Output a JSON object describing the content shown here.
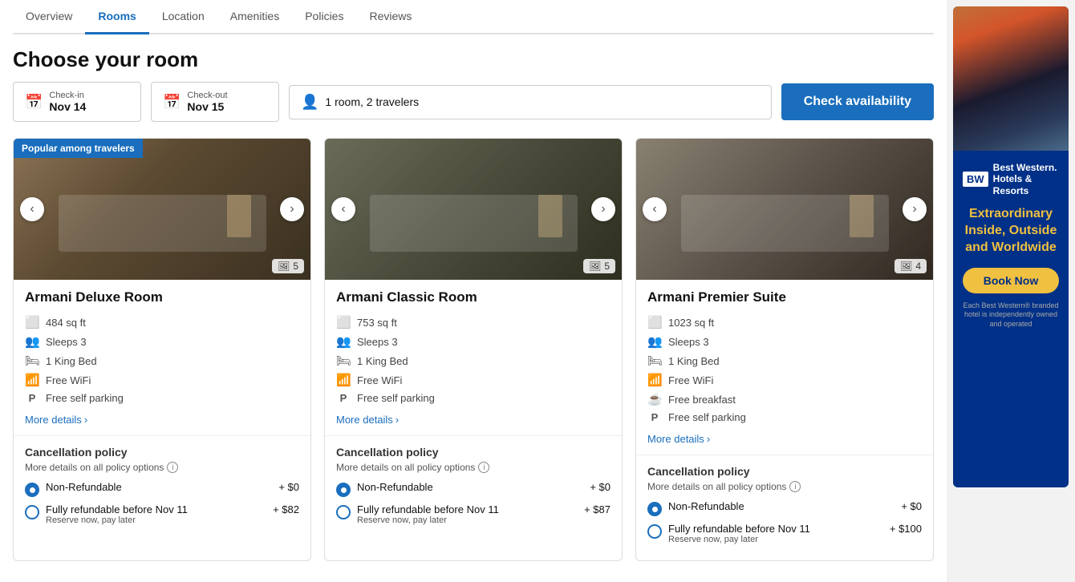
{
  "nav": {
    "tabs": [
      {
        "label": "Overview",
        "active": false
      },
      {
        "label": "Rooms",
        "active": true
      },
      {
        "label": "Location",
        "active": false
      },
      {
        "label": "Amenities",
        "active": false
      },
      {
        "label": "Policies",
        "active": false
      },
      {
        "label": "Reviews",
        "active": false
      }
    ]
  },
  "page": {
    "title": "Choose your room"
  },
  "availability": {
    "checkin_label": "Check-in",
    "checkin_value": "Nov 14",
    "checkout_label": "Check-out",
    "checkout_value": "Nov 15",
    "travelers_value": "1 room, 2 travelers",
    "button_label": "Check availability"
  },
  "rooms": [
    {
      "name": "Armani Deluxe Room",
      "popular_badge": "Popular among travelers",
      "image_count": 5,
      "sq_ft": "484 sq ft",
      "sleeps": "Sleeps 3",
      "bed": "1 King Bed",
      "wifi": "Free WiFi",
      "parking": "Free self parking",
      "more_details": "More details",
      "cancellation_title": "Cancellation policy",
      "cancellation_info": "More details on all policy options",
      "policies": [
        {
          "label": "Non-Refundable",
          "price": "+ $0",
          "sublabel": "",
          "selected": true
        },
        {
          "label": "Fully refundable before Nov 11",
          "price": "+ $82",
          "sublabel": "Reserve now, pay later",
          "selected": false
        }
      ]
    },
    {
      "name": "Armani Classic Room",
      "popular_badge": "",
      "image_count": 5,
      "sq_ft": "753 sq ft",
      "sleeps": "Sleeps 3",
      "bed": "1 King Bed",
      "wifi": "Free WiFi",
      "parking": "Free self parking",
      "more_details": "More details",
      "cancellation_title": "Cancellation policy",
      "cancellation_info": "More details on all policy options",
      "policies": [
        {
          "label": "Non-Refundable",
          "price": "+ $0",
          "sublabel": "",
          "selected": true
        },
        {
          "label": "Fully refundable before Nov 11",
          "price": "+ $87",
          "sublabel": "Reserve now, pay later",
          "selected": false
        }
      ]
    },
    {
      "name": "Armani Premier Suite",
      "popular_badge": "",
      "image_count": 4,
      "sq_ft": "1023 sq ft",
      "sleeps": "Sleeps 3",
      "bed": "1 King Bed",
      "wifi": "Free WiFi",
      "breakfast": "Free breakfast",
      "parking": "Free self parking",
      "more_details": "More details",
      "cancellation_title": "Cancellation policy",
      "cancellation_info": "More details on all policy options",
      "policies": [
        {
          "label": "Non-Refundable",
          "price": "+ $0",
          "sublabel": "",
          "selected": true
        },
        {
          "label": "Fully refundable before Nov 11",
          "price": "+ $100",
          "sublabel": "Reserve now, pay later",
          "selected": false
        }
      ]
    }
  ],
  "ad": {
    "logo_bw": "BW",
    "logo_name": "Best Western.\nHotels & Resorts",
    "headline": "Extraordinary Inside, Outside and Worldwide",
    "book_btn": "Book Now",
    "disclaimer": "Each Best Western® branded hotel is independently owned and operated"
  }
}
